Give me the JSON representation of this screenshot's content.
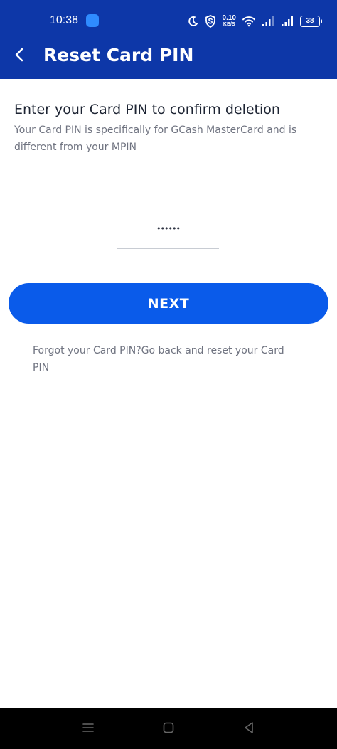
{
  "status_bar": {
    "time": "10:38",
    "network_speed": "0.10",
    "speed_unit": "KB/S",
    "battery": "38"
  },
  "header": {
    "title": "Reset Card PIN",
    "back_icon": "chevron-left-icon"
  },
  "form": {
    "heading": "Enter your Card PIN to confirm deletion",
    "description": "Your Card PIN is specifically for GCash MasterCard and is different from your MPIN",
    "pin_value": "••••••"
  },
  "actions": {
    "next_label": "NEXT",
    "forgot_text": "Forgot your Card PIN?Go back and reset your Card PIN"
  },
  "colors": {
    "header_blue": "#0d37a8",
    "button_blue": "#0a5bea",
    "text_dark": "#1d2433",
    "text_muted": "#6f7380"
  }
}
